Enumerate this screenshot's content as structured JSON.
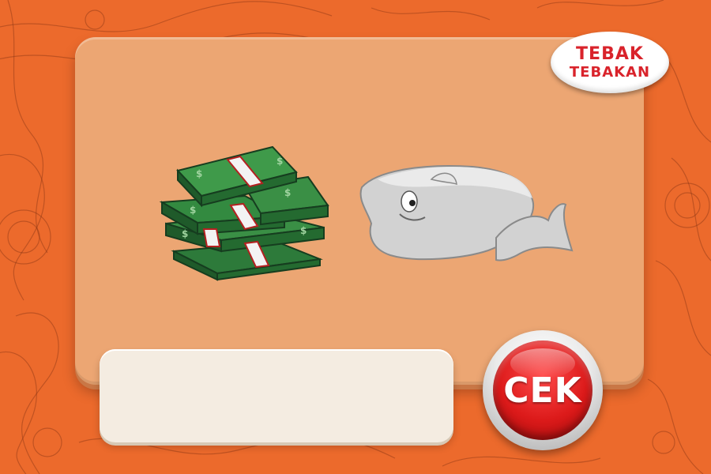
{
  "logo": {
    "line1": "TEBAK",
    "line2": "TEBAKAN"
  },
  "clues": [
    {
      "icon": "money-stacks-icon"
    },
    {
      "icon": "whale-icon"
    }
  ],
  "answer": {
    "value": "",
    "placeholder": ""
  },
  "check_button": {
    "label": "CEK"
  },
  "colors": {
    "background": "#ec6a2c",
    "card": "#eca673",
    "answer_box": "#f4ece1",
    "button_red": "#dc1a1a",
    "logo_red": "#d9232b"
  }
}
